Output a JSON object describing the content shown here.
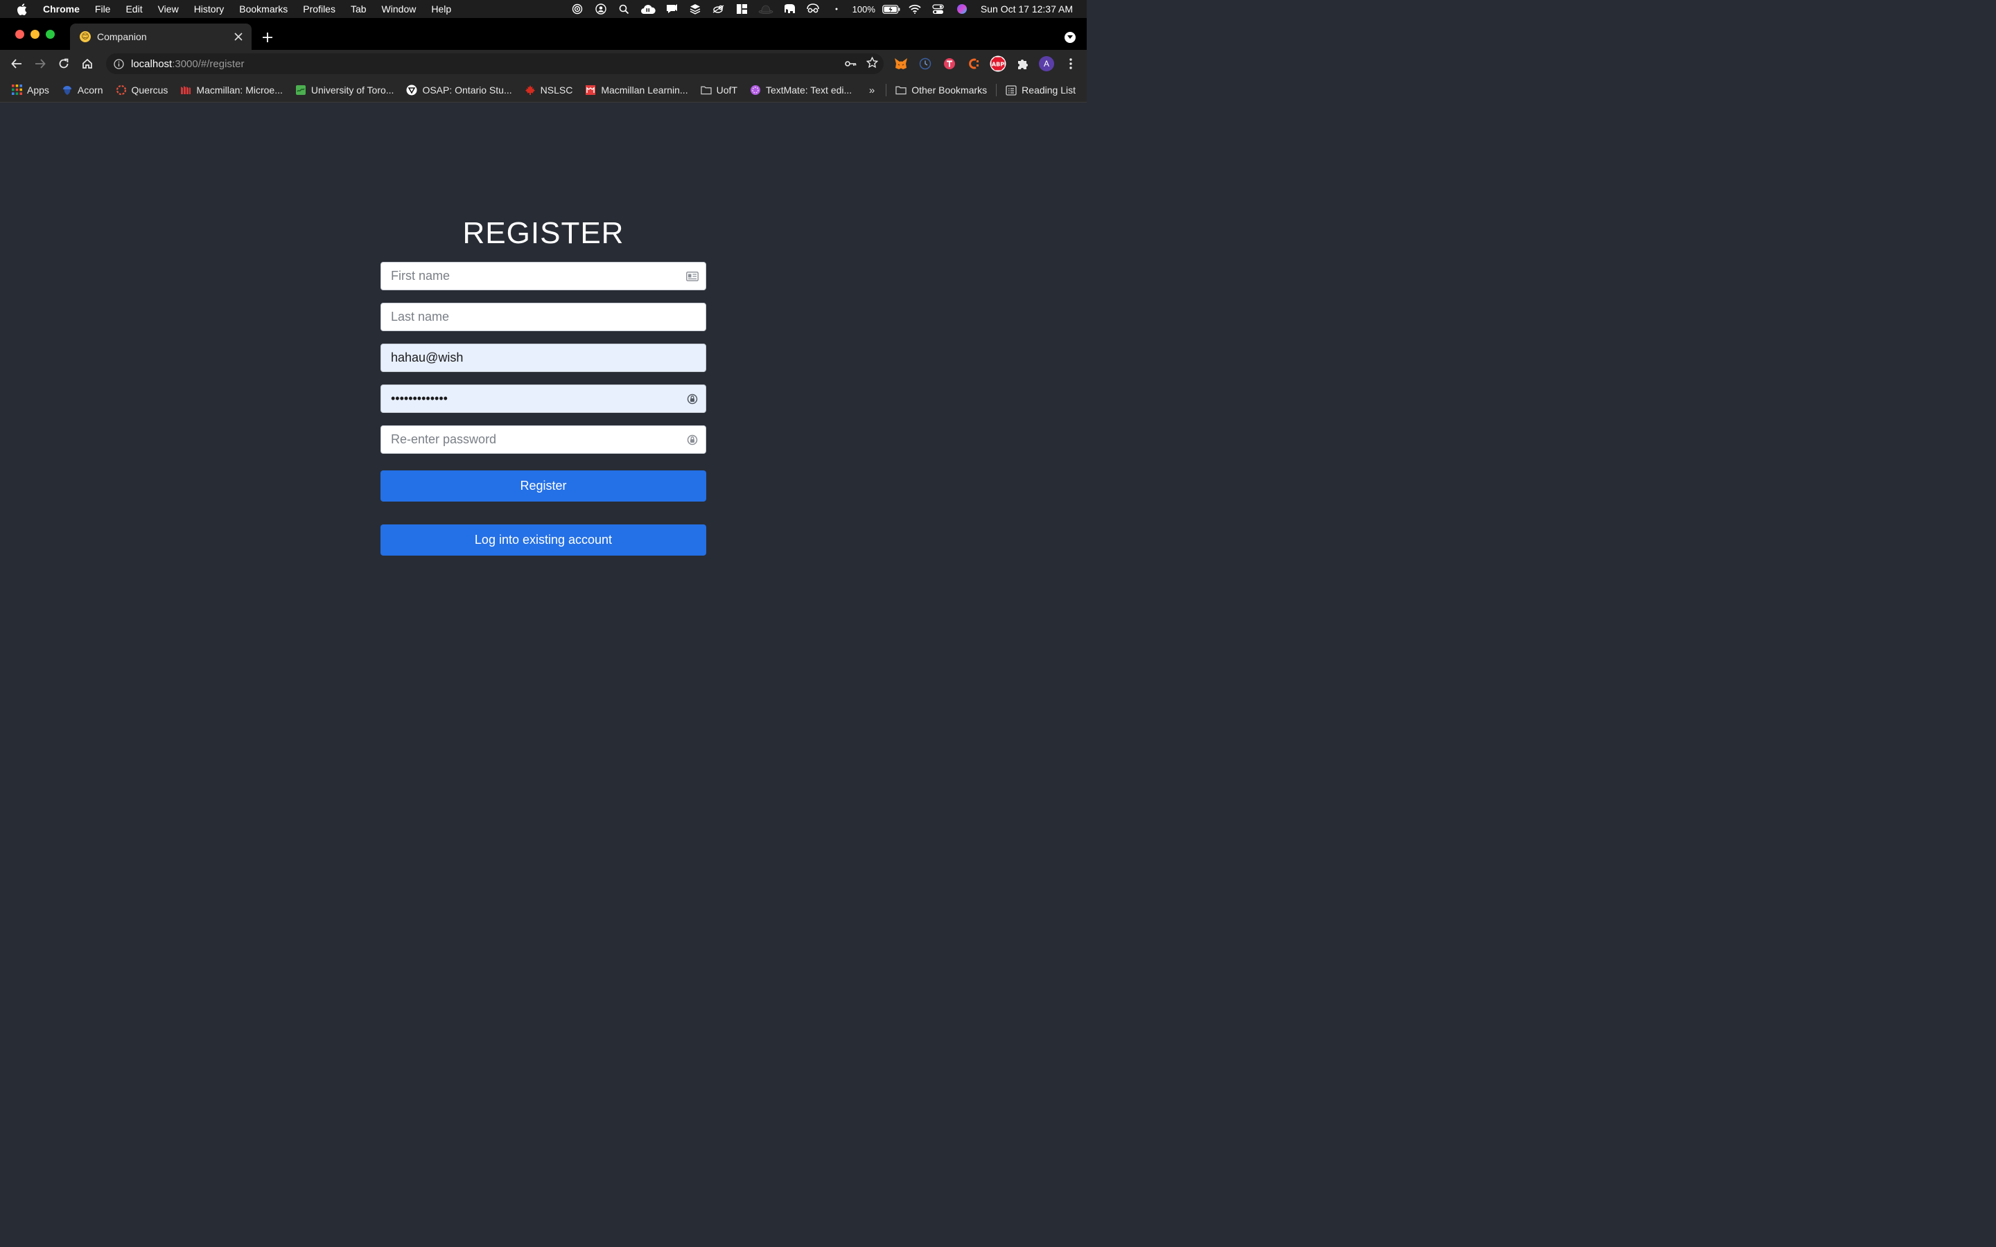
{
  "menubar": {
    "app_name": "Chrome",
    "items": [
      "File",
      "Edit",
      "View",
      "History",
      "Bookmarks",
      "Profiles",
      "Tab",
      "Window",
      "Help"
    ],
    "battery": "100%",
    "clock": "Sun Oct 17  12:37 AM"
  },
  "tab": {
    "title": "Companion",
    "favicon": "😊"
  },
  "omnibox": {
    "host": "localhost",
    "path": ":3000/#/register"
  },
  "bookmarks": {
    "items": [
      {
        "label": "Apps",
        "icon": "apps-grid-icon",
        "color": "#e8453c"
      },
      {
        "label": "Acorn",
        "icon": "acorn-icon",
        "color": "#3b6fd4"
      },
      {
        "label": "Quercus",
        "icon": "quercus-icon",
        "color": "#e1523d"
      },
      {
        "label": "Macmillan: Microe...",
        "icon": "macmillan-icon",
        "color": "#d8393a"
      },
      {
        "label": "University of Toro...",
        "icon": "uoft-icon",
        "color": "#4caf50"
      },
      {
        "label": "OSAP: Ontario Stu...",
        "icon": "osap-icon",
        "color": "#ffffff"
      },
      {
        "label": "NSLSC",
        "icon": "maple-leaf-icon",
        "color": "#d52b1e"
      },
      {
        "label": "Macmillan Learnin...",
        "icon": "macmillan-learning-icon",
        "color": "#e23b3b"
      },
      {
        "label": "UofT",
        "icon": "folder-icon",
        "color": "#cfcfcf"
      },
      {
        "label": "TextMate: Text edi...",
        "icon": "textmate-icon",
        "color": "#b05be0"
      }
    ],
    "overflow": "»",
    "other": "Other Bookmarks",
    "reading_list": "Reading List"
  },
  "page": {
    "title": "REGISTER",
    "first_name_placeholder": "First name",
    "last_name_placeholder": "Last name",
    "email_value": "hahau@wish",
    "password_value": "•••••••••••••",
    "reenter_placeholder": "Re-enter password",
    "register_label": "Register",
    "login_label": "Log into existing account"
  },
  "colors": {
    "page_bg": "#282c34",
    "primary_button": "#2470e6",
    "autofill_bg": "#e8f0fe"
  }
}
